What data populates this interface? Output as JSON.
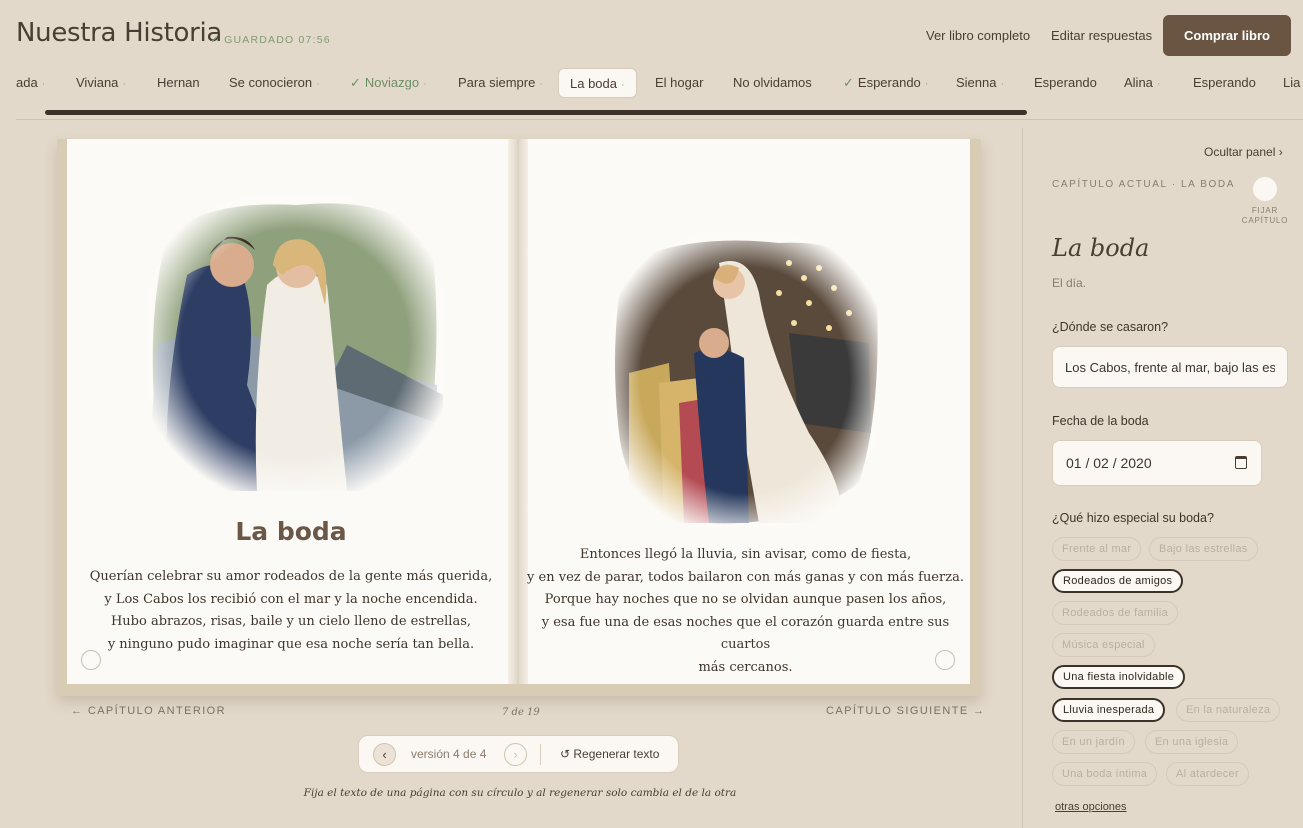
{
  "header": {
    "title": "Nuestra Historia",
    "saved": "✓ GUARDADO 07:56",
    "view_book": "Ver libro completo",
    "edit_answers": "Editar respuestas",
    "buy": "Comprar libro"
  },
  "tabs": [
    {
      "label": "ada",
      "dot": "·"
    },
    {
      "label": "Viviana",
      "dot": "·"
    },
    {
      "label": "Hernan",
      "dot": ""
    },
    {
      "label": "Se conocieron",
      "dot": "·"
    },
    {
      "label": "Noviazgo",
      "dot": "·",
      "done": true
    },
    {
      "label": "Para siempre",
      "dot": "·"
    },
    {
      "label": "La boda",
      "dot": "·",
      "active": true
    },
    {
      "label": "El hogar",
      "dot": ""
    },
    {
      "label": "No olvidamos",
      "dot": ""
    },
    {
      "label": "Esperando",
      "dot": "·",
      "done": true
    },
    {
      "label": "Sienna",
      "dot": "·"
    },
    {
      "label": "Esperando",
      "dot": ""
    },
    {
      "label": "Alina",
      "dot": "·"
    },
    {
      "label": "Esperando",
      "dot": ""
    },
    {
      "label": "Lia",
      "dot": ""
    }
  ],
  "book": {
    "chapter_title": "La boda",
    "left_verse": [
      "Querían celebrar su amor rodeados de la gente más querida,",
      "y Los Cabos los recibió con el mar y la noche encendida.",
      "Hubo abrazos, risas, baile y un cielo lleno de estrellas,",
      "y ninguno pudo imaginar que esa noche sería tan bella."
    ],
    "right_verse": [
      "Entonces llegó la lluvia, sin avisar, como de fiesta,",
      "y en vez de parar, todos bailaron con más ganas y con más fuerza.",
      "Porque hay noches que no se olvidan aunque pasen los años,",
      "y esa fue una de esas noches que el corazón guarda entre sus cuartos",
      "más cercanos."
    ]
  },
  "nav": {
    "prev": "← CAPÍTULO ANTERIOR",
    "next": "CAPÍTULO SIGUIENTE →",
    "page_count": "7 de 19"
  },
  "version": {
    "label": "versión 4 de 4",
    "regen": "↺ Regenerar texto",
    "prev_glyph": "‹",
    "next_glyph": "›"
  },
  "hint": "Fija el texto de una página con su círculo y al regenerar solo cambia el de la otra",
  "panel": {
    "hide": "Ocultar panel ›",
    "current_chapter": "CAPÍTULO ACTUAL · LA BODA",
    "pin_label": "FIJAR CAPÍTULO",
    "title": "La boda",
    "subtitle": "El día.",
    "q1": "¿Dónde se casaron?",
    "q1_value": "Los Cabos, frente al mar, bajo las estrellas",
    "q2": "Fecha de la boda",
    "q2_value": "01 / 02 / 2020",
    "q3": "¿Qué hizo especial su boda?",
    "chips": [
      {
        "label": "Frente al mar",
        "selected": false
      },
      {
        "label": "Bajo las estrellas",
        "selected": false
      },
      {
        "label": "Rodeados de amigos",
        "selected": true
      },
      {
        "label": "Rodeados de familia",
        "selected": false
      },
      {
        "label": "Música especial",
        "selected": false
      },
      {
        "label": "Una fiesta inolvidable",
        "selected": true
      },
      {
        "label": "Lluvia inesperada",
        "selected": true
      },
      {
        "label": "En la naturaleza",
        "selected": false
      },
      {
        "label": "En un jardín",
        "selected": false
      },
      {
        "label": "En una iglesia",
        "selected": false
      },
      {
        "label": "Una boda íntima",
        "selected": false
      },
      {
        "label": "Al atardecer",
        "selected": false
      }
    ],
    "more": "otras opciones"
  },
  "colors": {
    "background": "#e3d9ca",
    "accent": "#6a5542",
    "done_green": "#6e8f64",
    "page": "#fcfaf6"
  }
}
